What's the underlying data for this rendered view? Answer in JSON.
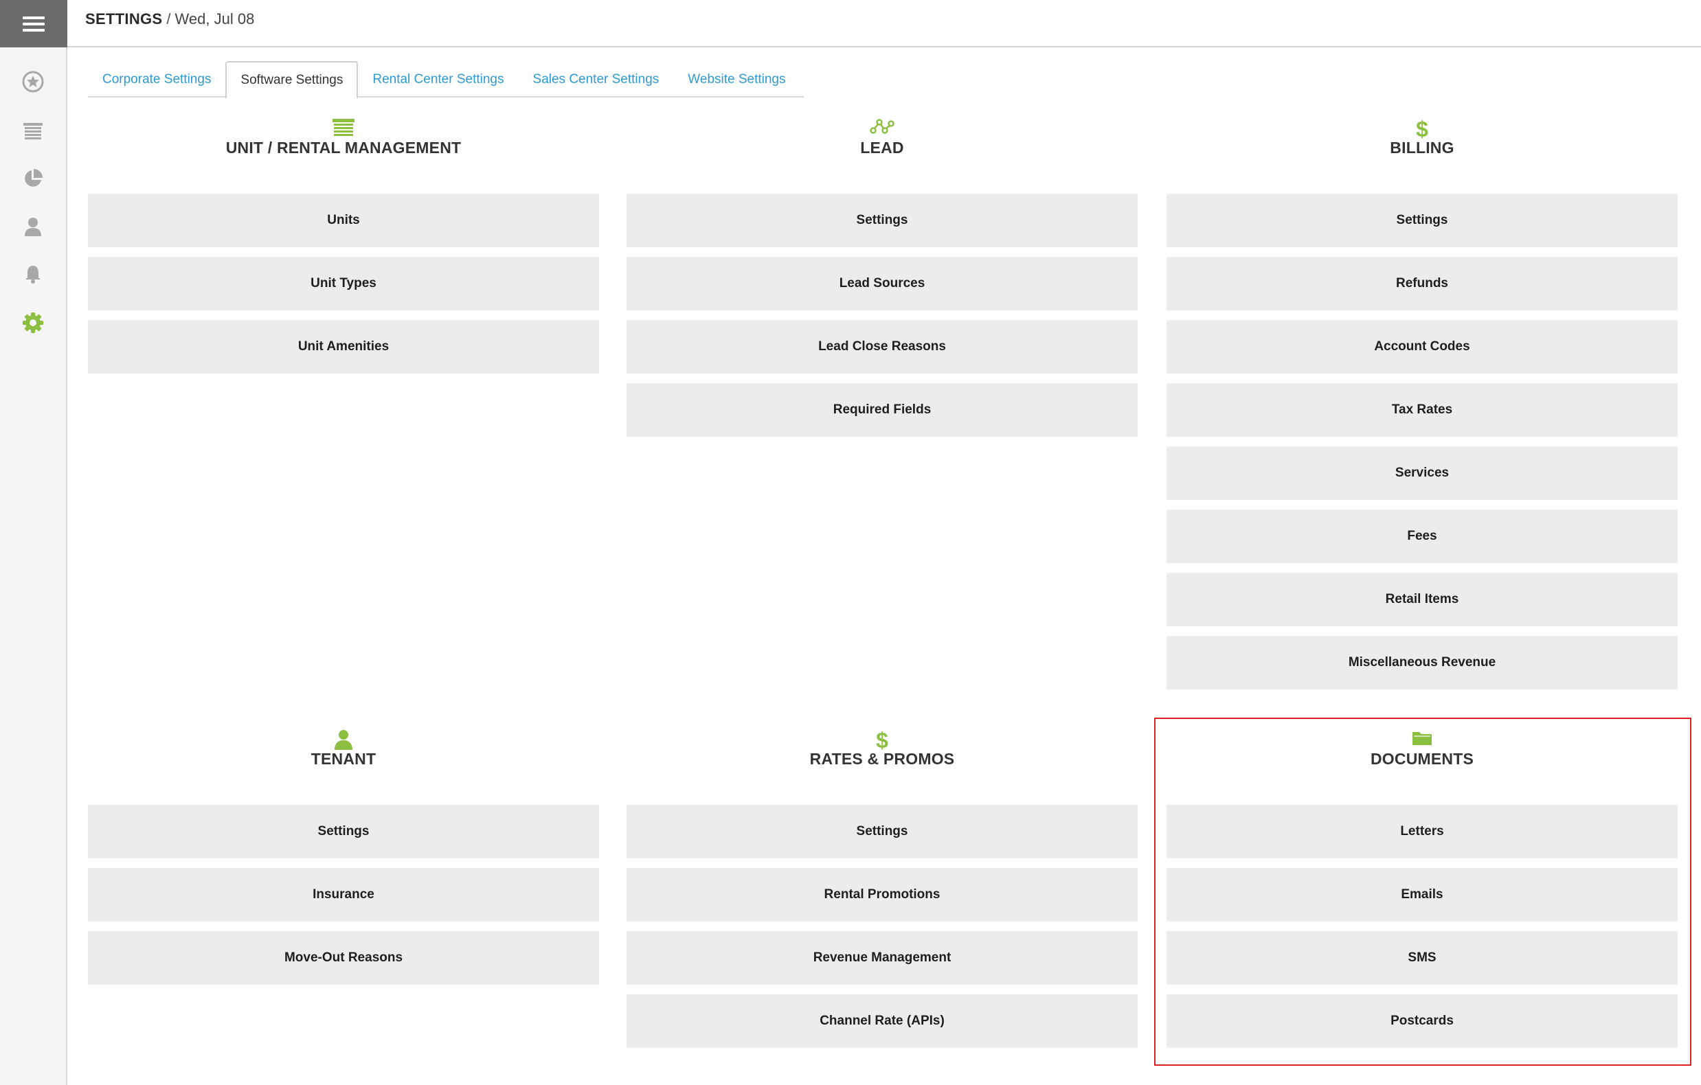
{
  "header": {
    "title": "SETTINGS",
    "separator": "/",
    "date": "Wed, Jul 08"
  },
  "sidebar": {
    "items": [
      {
        "icon": "menu-icon"
      },
      {
        "icon": "star-icon"
      },
      {
        "icon": "units-icon"
      },
      {
        "icon": "pie-chart-icon"
      },
      {
        "icon": "user-icon"
      },
      {
        "icon": "bell-icon"
      },
      {
        "icon": "gear-icon",
        "active": true
      }
    ]
  },
  "tabs": [
    {
      "label": "Corporate Settings"
    },
    {
      "label": "Software Settings",
      "active": true
    },
    {
      "label": "Rental Center Settings"
    },
    {
      "label": "Sales Center Settings"
    },
    {
      "label": "Website Settings"
    }
  ],
  "sections": {
    "unit": {
      "title": "UNIT / RENTAL MANAGEMENT",
      "icon": "garage-door-icon",
      "items": [
        "Units",
        "Unit Types",
        "Unit Amenities"
      ]
    },
    "lead": {
      "title": "LEAD",
      "icon": "lead-network-icon",
      "items": [
        "Settings",
        "Lead Sources",
        "Lead Close Reasons",
        "Required Fields"
      ]
    },
    "billing": {
      "title": "BILLING",
      "icon": "dollar-icon",
      "items": [
        "Settings",
        "Refunds",
        "Account Codes",
        "Tax Rates",
        "Services",
        "Fees",
        "Retail Items",
        "Miscellaneous Revenue"
      ]
    },
    "tenant": {
      "title": "TENANT",
      "icon": "user-icon",
      "items": [
        "Settings",
        "Insurance",
        "Move-Out Reasons"
      ]
    },
    "rates": {
      "title": "RATES & PROMOS",
      "icon": "dollar-icon",
      "items": [
        "Settings",
        "Rental Promotions",
        "Revenue Management",
        "Channel Rate (APIs)"
      ]
    },
    "documents": {
      "title": "DOCUMENTS",
      "icon": "folder-icon",
      "items": [
        "Letters",
        "Emails",
        "SMS",
        "Postcards"
      ]
    }
  },
  "colors": {
    "accent_green": "#8cbf3f",
    "link_blue": "#2e9ad3",
    "tile_gray": "#ececec",
    "highlight_red": "#e02020",
    "sidebar_dark": "#6b6b6b"
  }
}
